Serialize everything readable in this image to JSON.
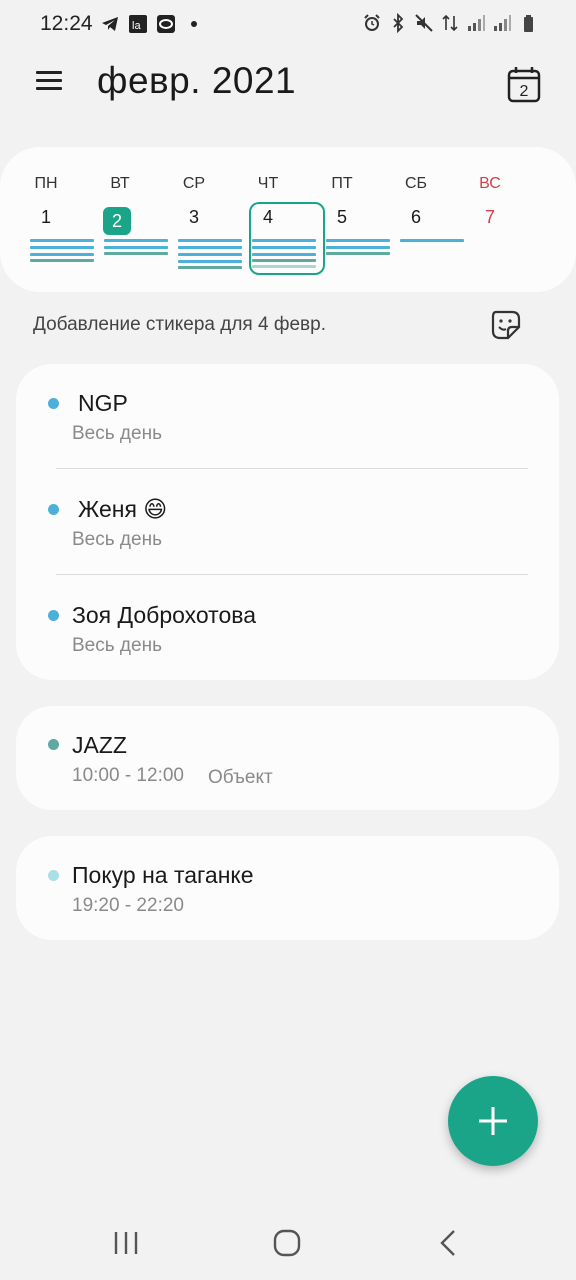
{
  "status_bar": {
    "time": "12:24",
    "left_icons": [
      "telegram-icon",
      "la-app-icon",
      "tinkoff-icon",
      "dot-icon"
    ],
    "right_icons": [
      "alarm-icon",
      "bluetooth-icon",
      "mute-icon",
      "data-arrows-icon",
      "signal-icon",
      "signal-icon",
      "battery-icon"
    ]
  },
  "header": {
    "title": "февр. 2021",
    "today_button_number": "2"
  },
  "week": {
    "days": [
      {
        "name": "ПН",
        "num": "1"
      },
      {
        "name": "ВТ",
        "num": "2"
      },
      {
        "name": "СР",
        "num": "3"
      },
      {
        "name": "ЧТ",
        "num": "4"
      },
      {
        "name": "ПТ",
        "num": "5"
      },
      {
        "name": "СБ",
        "num": "6"
      },
      {
        "name": "ВС",
        "num": "7"
      }
    ],
    "today_index": 1,
    "selected_index": 3
  },
  "sticker": {
    "text": "Добавление стикера для 4 февр."
  },
  "cards": [
    {
      "events": [
        {
          "title": "NGP",
          "time": "Весь день",
          "color": "#4db0d8"
        },
        {
          "title": "Женя 😄",
          "time": "Весь день",
          "color": "#4db0d8"
        },
        {
          "title": "Зоя Доброхотова",
          "time": "Весь день",
          "color": "#4db0d8"
        }
      ]
    },
    {
      "events": [
        {
          "title": "JAZZ",
          "time": "10:00 - 12:00",
          "location": "Объект",
          "color": "#5fa9a0"
        }
      ]
    },
    {
      "events": [
        {
          "title": "Покур на таганке",
          "time": "19:20 - 22:20",
          "color": "#a8e0e6"
        }
      ]
    }
  ],
  "colors": {
    "accent": "#1ba588",
    "sunday": "#d0414a",
    "event_blue": "#4db0d8",
    "event_teal": "#5fa9a0",
    "event_light": "#a8e0e6"
  }
}
